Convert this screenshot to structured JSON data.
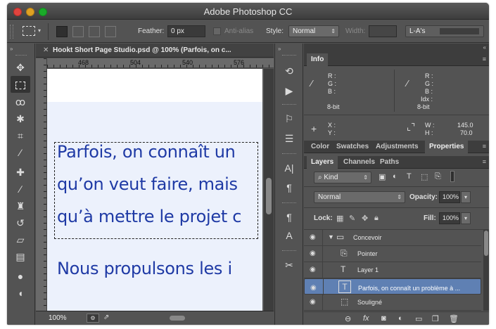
{
  "window": {
    "title": "Adobe Photoshop CC"
  },
  "options_bar": {
    "feather_label": "Feather:",
    "feather_value": "0 px",
    "antialias_label": "Anti-alias",
    "style_label": "Style:",
    "style_value": "Normal",
    "width_label": "Width:",
    "width_value": "",
    "workspace_value": "L-A's"
  },
  "tools": [
    "move-tool",
    "marquee-tool",
    "lasso-tool",
    "quick-selection-tool",
    "crop-tool",
    "eyedropper-tool",
    "healing-brush-tool",
    "brush-tool",
    "clone-stamp-tool",
    "history-brush-tool",
    "eraser-tool",
    "gradient-tool",
    "blur-tool",
    "dodge-tool"
  ],
  "document": {
    "tab_title": "Hookt Short Page Studio.psd @ 100% (Parfois, on c...",
    "ruler_ticks": [
      "468",
      "504",
      "540",
      "576"
    ],
    "lines": [
      "Parfois, on connaît un",
      "qu’on veut faire, mais",
      "qu’à mettre le projet c",
      "Nous propulsons les i"
    ],
    "zoom": "100%",
    "text_color": "#1f3aa5",
    "page_color": "#ecf1fc"
  },
  "info_panel": {
    "tab": "Info",
    "rgb_labels": [
      "R :",
      "G :",
      "B :"
    ],
    "right_labels": [
      "R :",
      "G :",
      "B :",
      "Idx :"
    ],
    "bit_left": "8-bit",
    "bit_right": "8-bit",
    "xy_labels": [
      "X :",
      "Y :"
    ],
    "wh_labels": [
      "W :",
      "H :"
    ],
    "w_value": "145.0",
    "h_value": "70.0"
  },
  "panel_tabs": [
    "Color",
    "Swatches",
    "Adjustments",
    "Properties"
  ],
  "layers_tabs": [
    "Layers",
    "Channels",
    "Paths"
  ],
  "layers_panel": {
    "filter_kind": "Kind",
    "blend_mode": "Normal",
    "opacity_label": "Opacity:",
    "opacity_value": "100%",
    "lock_label": "Lock:",
    "fill_label": "Fill:",
    "fill_value": "100%",
    "layers": [
      {
        "name": "Concevoir",
        "kind": "group"
      },
      {
        "name": "Pointer",
        "kind": "smart"
      },
      {
        "name": "Layer 1",
        "kind": "text"
      },
      {
        "name": "Parfois, on connaît un problème à ...",
        "kind": "text",
        "selected": true
      },
      {
        "name": "Souligné",
        "kind": "shape"
      }
    ],
    "selected_color": "#5f80b3"
  }
}
